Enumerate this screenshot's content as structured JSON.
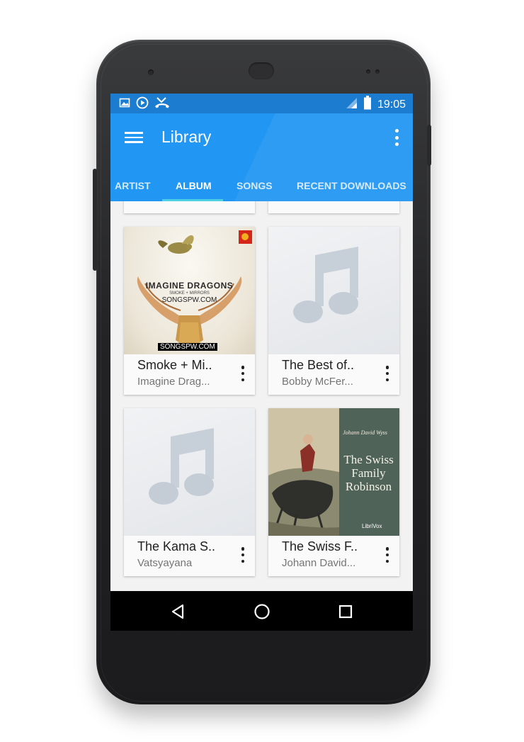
{
  "status_bar": {
    "time": "19:05"
  },
  "app_bar": {
    "title": "Library"
  },
  "tabs": [
    {
      "label": "ARTIST"
    },
    {
      "label": "ALBUM",
      "active": true
    },
    {
      "label": "SONGS"
    },
    {
      "label": "RECENT DOWNLOADS"
    }
  ],
  "albums": [
    {
      "name": "Smoke + Mi..",
      "artist": "Imagine Drag...",
      "cover": {
        "title": "IMAGINE DRAGONS",
        "subtitle": "SMOKE + MIRRORS",
        "watermark": "SONGSPW.COM",
        "footer": "SONGSPW.COM"
      }
    },
    {
      "name": "The Best of..",
      "artist": "Bobby McFer...",
      "cover": null
    },
    {
      "name": "The Kama S..",
      "artist": "Vatsyayana",
      "cover": null
    },
    {
      "name": "The Swiss F..",
      "artist": "Johann David...",
      "cover": {
        "author": "Johann David Wyss",
        "title_line1": "The Swiss",
        "title_line2": "Family",
        "title_line3": "Robinson",
        "publisher": "LibriVox"
      }
    }
  ],
  "colors": {
    "status_bar": "#1c7ccf",
    "app_bar": "#2196f3",
    "tab_indicator": "#4dd0e1",
    "content_bg": "#f2f2f2"
  },
  "icons": [
    "image-icon",
    "play-circle-icon",
    "missed-call-icon",
    "signal-icon",
    "battery-icon",
    "menu-icon",
    "more-vert-icon",
    "music-note-icon",
    "back-icon",
    "home-icon",
    "recents-icon"
  ]
}
